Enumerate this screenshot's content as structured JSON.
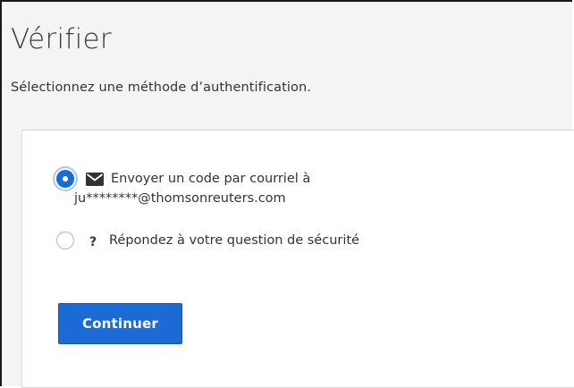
{
  "header": {
    "title": "Vérifier",
    "subtitle": "Sélectionnez une méthode d’authentification."
  },
  "options": [
    {
      "id": "email",
      "icon": "mail-icon",
      "label_line1": "Envoyer un code par courriel à",
      "label_line2": "ju********@thomsonreuters.com",
      "selected": true
    },
    {
      "id": "question",
      "icon": "question-icon",
      "icon_glyph": "?",
      "label": "Répondez à votre question de sécurité",
      "selected": false
    }
  ],
  "actions": {
    "continue_label": "Continuer"
  },
  "colors": {
    "accent": "#1a6bd6",
    "header_bg": "#f4f4f4",
    "text": "#333333"
  }
}
